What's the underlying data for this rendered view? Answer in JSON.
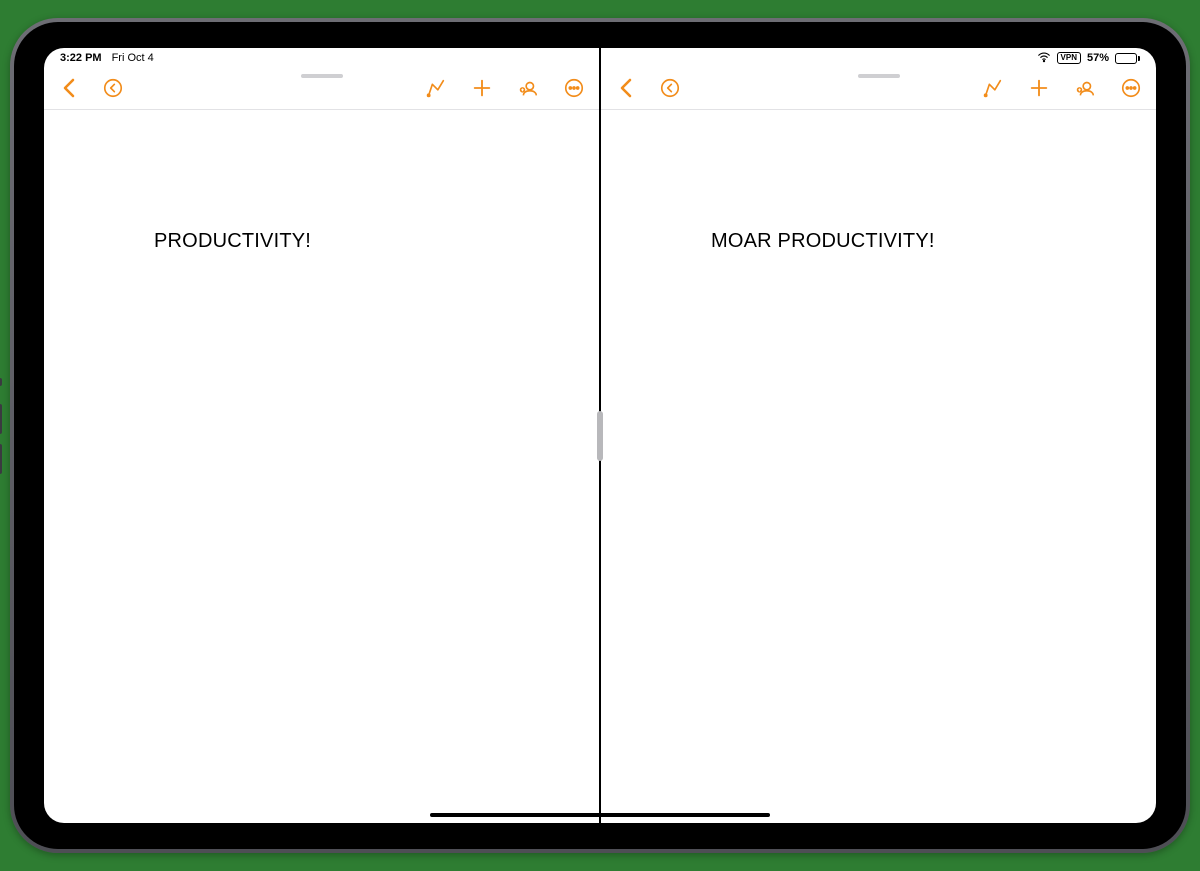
{
  "status": {
    "time": "3:22 PM",
    "date": "Fri Oct 4",
    "vpn": "VPN",
    "battery_pct": "57%"
  },
  "left": {
    "content": "PRODUCTIVITY!"
  },
  "right": {
    "content": "MOAR PRODUCTIVITY!"
  }
}
